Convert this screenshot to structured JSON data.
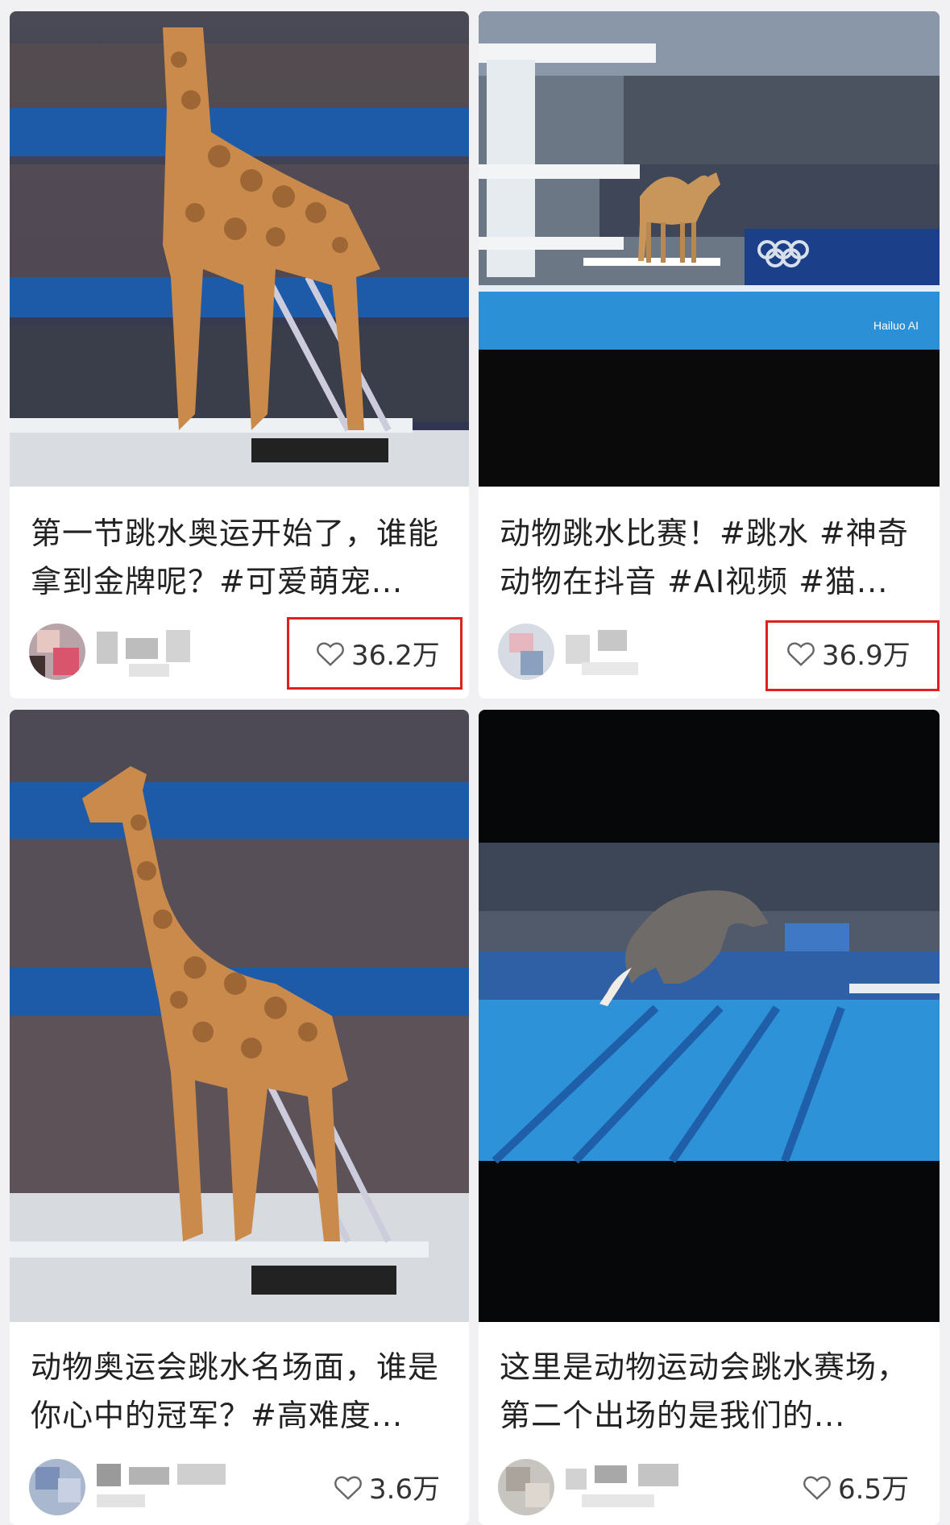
{
  "cards": [
    {
      "title": "第一节跳水奥运开始了，谁能拿到金牌呢？#可爱萌宠...",
      "likes": "36.2万",
      "highlighted": true
    },
    {
      "title": "动物跳水比赛！#跳水 #神奇动物在抖音 #AI视频 #猫...",
      "likes": "36.9万",
      "highlighted": true,
      "watermark": "Hailuo AI"
    },
    {
      "title": "动物奥运会跳水名场面，谁是你心中的冠军？#高难度...",
      "likes": "3.6万",
      "highlighted": false
    },
    {
      "title": "这里是动物运动会跳水赛场，第二个出场的是我们的...",
      "likes": "6.5万",
      "highlighted": false
    }
  ],
  "icons": {
    "like": "heart-outline-icon"
  },
  "colors": {
    "highlight": "#e0201e",
    "pool": "#2f8fd8",
    "giraffe": "#c98a4b"
  }
}
